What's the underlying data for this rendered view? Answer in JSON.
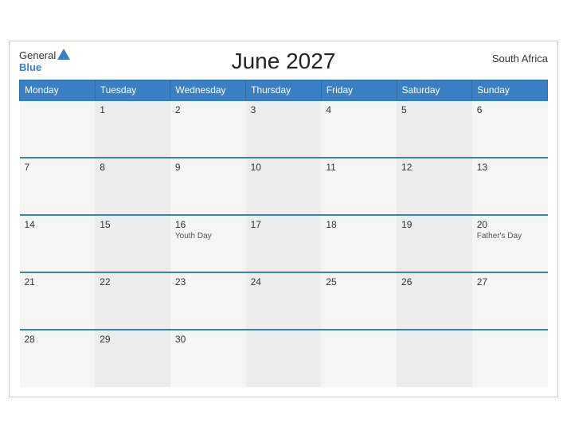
{
  "header": {
    "title": "June 2027",
    "country": "South Africa",
    "logo_general": "General",
    "logo_blue": "Blue"
  },
  "weekdays": [
    "Monday",
    "Tuesday",
    "Wednesday",
    "Thursday",
    "Friday",
    "Saturday",
    "Sunday"
  ],
  "weeks": [
    [
      {
        "day": "",
        "event": ""
      },
      {
        "day": "1",
        "event": ""
      },
      {
        "day": "2",
        "event": ""
      },
      {
        "day": "3",
        "event": ""
      },
      {
        "day": "4",
        "event": ""
      },
      {
        "day": "5",
        "event": ""
      },
      {
        "day": "6",
        "event": ""
      }
    ],
    [
      {
        "day": "7",
        "event": ""
      },
      {
        "day": "8",
        "event": ""
      },
      {
        "day": "9",
        "event": ""
      },
      {
        "day": "10",
        "event": ""
      },
      {
        "day": "11",
        "event": ""
      },
      {
        "day": "12",
        "event": ""
      },
      {
        "day": "13",
        "event": ""
      }
    ],
    [
      {
        "day": "14",
        "event": ""
      },
      {
        "day": "15",
        "event": ""
      },
      {
        "day": "16",
        "event": "Youth Day"
      },
      {
        "day": "17",
        "event": ""
      },
      {
        "day": "18",
        "event": ""
      },
      {
        "day": "19",
        "event": ""
      },
      {
        "day": "20",
        "event": "Father's Day"
      }
    ],
    [
      {
        "day": "21",
        "event": ""
      },
      {
        "day": "22",
        "event": ""
      },
      {
        "day": "23",
        "event": ""
      },
      {
        "day": "24",
        "event": ""
      },
      {
        "day": "25",
        "event": ""
      },
      {
        "day": "26",
        "event": ""
      },
      {
        "day": "27",
        "event": ""
      }
    ],
    [
      {
        "day": "28",
        "event": ""
      },
      {
        "day": "29",
        "event": ""
      },
      {
        "day": "30",
        "event": ""
      },
      {
        "day": "",
        "event": ""
      },
      {
        "day": "",
        "event": ""
      },
      {
        "day": "",
        "event": ""
      },
      {
        "day": "",
        "event": ""
      }
    ]
  ]
}
